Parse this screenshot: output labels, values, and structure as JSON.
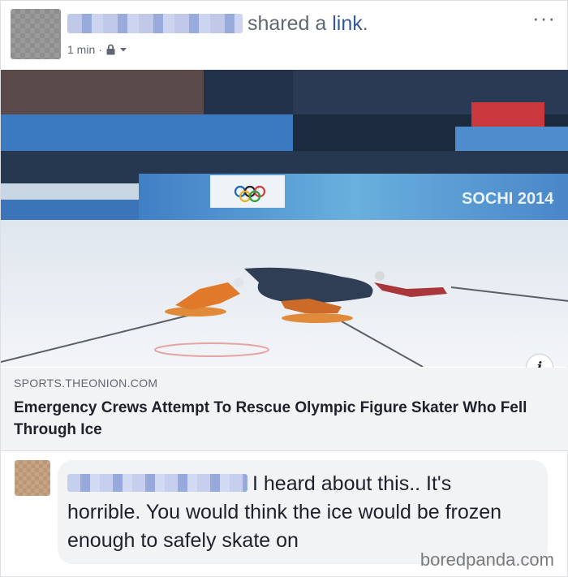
{
  "post": {
    "action_text": "shared a ",
    "action_link": "link",
    "action_end": ".",
    "time": "1 min",
    "separator": "·",
    "more_icon": "ellipsis-icon"
  },
  "link_preview": {
    "image_banner_text": "SOCHI 2014",
    "domain": "SPORTS.THEONION.COM",
    "headline": "Emergency Crews Attempt To Rescue Olympic Figure Skater Who Fell Through Ice",
    "info_icon": "i"
  },
  "comment": {
    "text": "I heard about this.. It's horrible. You would think the ice would be frozen enough to safely skate on"
  },
  "watermark": "boredpanda.com",
  "colors": {
    "link_blue": "#385898",
    "meta_gray": "#606770",
    "preview_bg": "#f2f3f5"
  }
}
